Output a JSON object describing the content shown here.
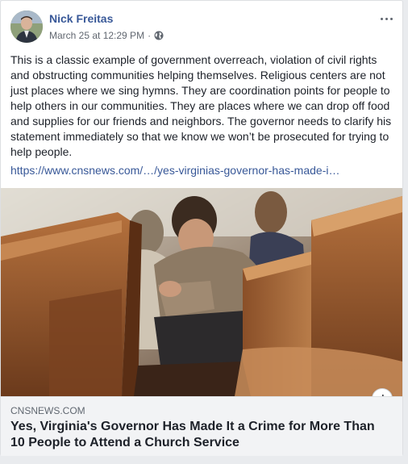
{
  "post": {
    "author": "Nick Freitas",
    "timestamp": "March 25 at 12:29 PM",
    "separator": "·",
    "privacy_icon": "globe-icon",
    "menu_icon": "more-options-icon",
    "text": "This is a classic example of government overreach, violation of civil rights and obstructing communities helping themselves. Religious centers are not just places where we sing hymns. They are coordination points for people to help others in our communities. They are places where we can drop off food and supplies for our friends and neighbors. The governor needs to clarify his statement immediately so that we know we won’t be prosecuted for trying to help people.",
    "link_text": "https://www.cnsnews.com/…/yes-virginias-governor-has-made-i…"
  },
  "link_preview": {
    "domain": "CNSNEWS.COM",
    "title": "Yes, Virginia's Governor Has Made It a Crime for More Than 10 People to Attend a Church Service",
    "info_label": "i"
  },
  "colors": {
    "author": "#385898",
    "text": "#1d2129",
    "meta": "#616770",
    "footer_bg": "#f2f3f5"
  }
}
